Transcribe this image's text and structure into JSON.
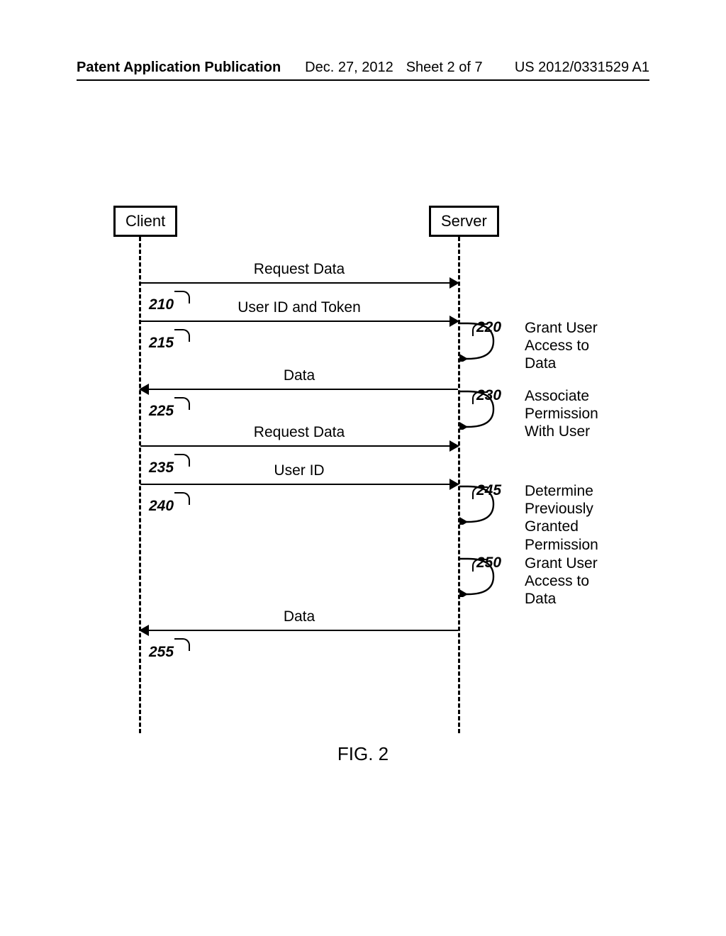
{
  "header": {
    "publication_label": "Patent Application Publication",
    "date": "Dec. 27, 2012",
    "sheet": "Sheet 2 of 7",
    "pub_number": "US 2012/0331529 A1"
  },
  "figure": {
    "caption": "FIG. 2",
    "participants": {
      "client": "Client",
      "server": "Server"
    },
    "messages": {
      "m210": {
        "ref": "210",
        "label": "Request Data",
        "from": "client",
        "to": "server"
      },
      "m215": {
        "ref": "215",
        "label": "User ID and Token",
        "from": "client",
        "to": "server"
      },
      "m225": {
        "ref": "225",
        "label": "Data",
        "from": "server",
        "to": "client"
      },
      "m235": {
        "ref": "235",
        "label": "Request Data",
        "from": "client",
        "to": "server"
      },
      "m240": {
        "ref": "240",
        "label": "User ID",
        "from": "client",
        "to": "server"
      },
      "m255": {
        "ref": "255",
        "label": "Data",
        "from": "server",
        "to": "client"
      }
    },
    "self_actions": {
      "s220": {
        "ref": "220",
        "label": "Grant User Access to Data",
        "at": "server"
      },
      "s230": {
        "ref": "230",
        "label": "Associate Permission With User",
        "at": "server"
      },
      "s245": {
        "ref": "245",
        "label": "Determine Previously Granted Permission",
        "at": "server"
      },
      "s250": {
        "ref": "250",
        "label": "Grant User Access to Data",
        "at": "server"
      }
    }
  }
}
